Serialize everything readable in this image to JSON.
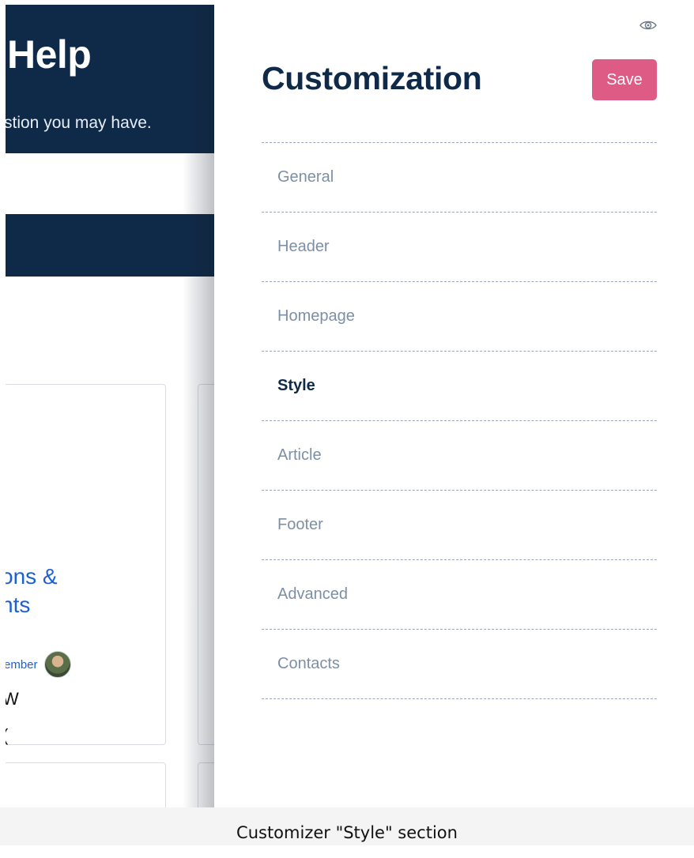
{
  "site": {
    "hero_title": "Help",
    "hero_subtitle": "stion you may have.",
    "card_link": "ons &\nnts",
    "author_text": "ember",
    "fragment_1": "W",
    "fragment_2": "("
  },
  "panel": {
    "title": "Customization",
    "save_label": "Save",
    "menu": [
      {
        "label": "General",
        "active": false
      },
      {
        "label": "Header",
        "active": false
      },
      {
        "label": "Homepage",
        "active": false
      },
      {
        "label": "Style",
        "active": true
      },
      {
        "label": "Article",
        "active": false
      },
      {
        "label": "Footer",
        "active": false
      },
      {
        "label": "Advanced",
        "active": false
      },
      {
        "label": "Contacts",
        "active": false
      }
    ]
  },
  "caption": "Customizer \"Style\" section",
  "colors": {
    "navy": "#0f2a48",
    "accent": "#de5b85",
    "muted": "#7d8fa6",
    "link": "#1c5fd6"
  },
  "icons": {
    "preview": "eye-icon"
  }
}
